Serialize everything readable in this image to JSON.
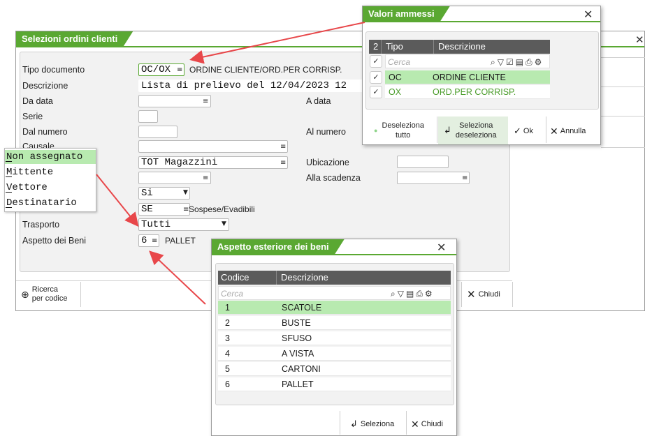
{
  "main": {
    "title": "Selezioni ordini clienti",
    "close_glyph": "✕",
    "labels": {
      "tipo_documento": "Tipo documento",
      "descrizione": "Descrizione",
      "da_data": "Da data",
      "a_data": "A data",
      "serie": "Serie",
      "dal_numero": "Dal numero",
      "al_numero": "Al numero",
      "causale": "Causale",
      "ubicazione": "Ubicazione",
      "alla_scadenza": "Alla scadenza",
      "trasporto": "Trasporto",
      "aspetto_beni": "Aspetto dei Beni"
    },
    "values": {
      "tipo_documento": "OC/OX",
      "tipo_documento_desc": "ORDINE CLIENTE/ORD.PER CORRISP.",
      "descrizione": "Lista di prelievo del 12/04/2023 12",
      "magazzino": "TOT Magazzini",
      "si_select": "Si",
      "se_field": "SE",
      "se_note": "Sospese/Evadibili",
      "trasporto": "Tutti",
      "aspetto": "6",
      "aspetto_desc": "PALLET"
    },
    "toolbar": {
      "ricerca_line1": "Ricerca",
      "ricerca_line2": "per codice",
      "chiudi": "Chiudi"
    }
  },
  "dest_list": {
    "items": [
      "Non assegnato",
      "Mittente",
      "Vettore",
      "Destinatario"
    ],
    "selected_index": 0
  },
  "popup_valori": {
    "title": "Valori ammessi",
    "count": "2",
    "columns": [
      "Tipo",
      "Descrizione"
    ],
    "search_placeholder": "Cerca",
    "rows": [
      {
        "tipo": "OC",
        "descrizione": "ORDINE CLIENTE",
        "checked": true,
        "selected": true
      },
      {
        "tipo": "OX",
        "descrizione": "ORD.PER CORRISP.",
        "checked": true,
        "selected": false
      }
    ],
    "buttons": {
      "deseleziona_line1": "Deseleziona",
      "deseleziona_line2": "tutto",
      "seleziona_line1": "Seleziona",
      "seleziona_line2": "deseleziona",
      "ok": "Ok",
      "annulla": "Annulla"
    }
  },
  "popup_aspetto": {
    "title": "Aspetto esteriore dei beni",
    "columns": [
      "Codice",
      "Descrizione"
    ],
    "search_placeholder": "Cerca",
    "rows": [
      {
        "codice": "1",
        "descrizione": "SCATOLE"
      },
      {
        "codice": "2",
        "descrizione": "BUSTE"
      },
      {
        "codice": "3",
        "descrizione": "SFUSO"
      },
      {
        "codice": "4",
        "descrizione": "A VISTA"
      },
      {
        "codice": "5",
        "descrizione": "CARTONI"
      },
      {
        "codice": "6",
        "descrizione": "PALLET"
      }
    ],
    "selected_index": 0,
    "buttons": {
      "seleziona": "Seleziona",
      "chiudi": "Chiudi"
    }
  },
  "colors": {
    "accent_green": "#5aa832",
    "row_selected": "#b8eab0",
    "grid_header": "#5b5b5b",
    "annotation_arrow": "#e8474a"
  }
}
